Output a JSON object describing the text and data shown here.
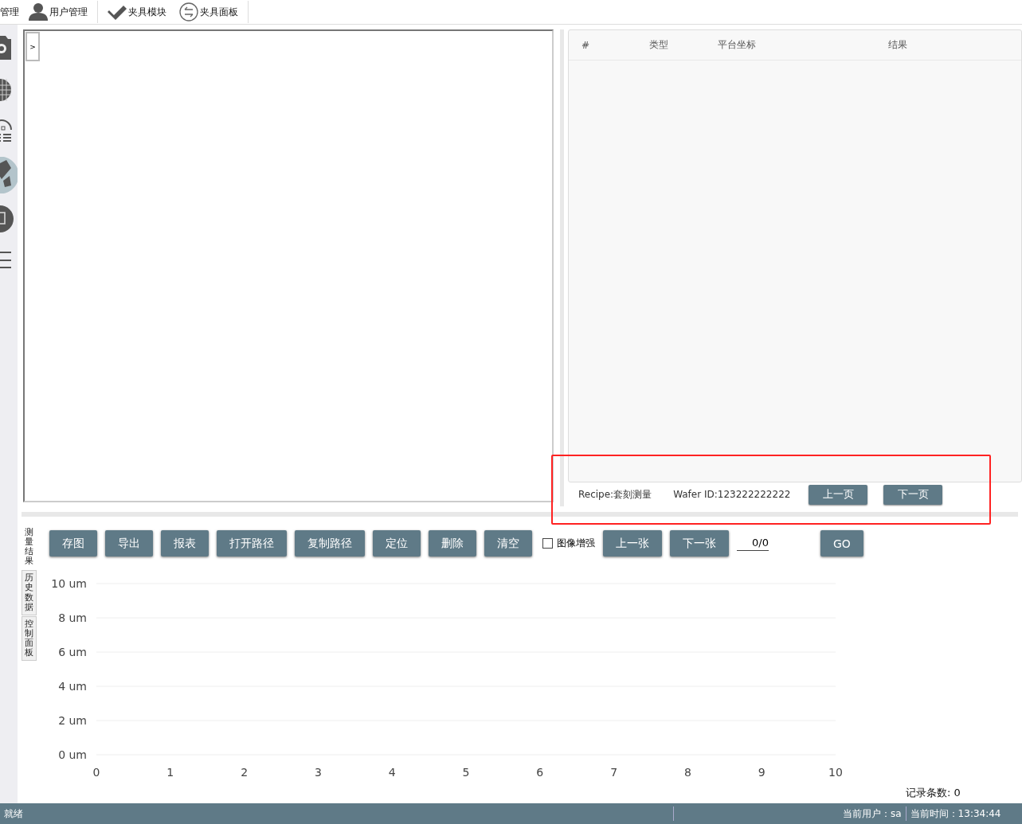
{
  "toolbar": {
    "items": [
      {
        "kind": "cut",
        "label": "管理"
      },
      {
        "kind": "user",
        "label": "用户管理"
      },
      {
        "kind": "separator"
      },
      {
        "kind": "tool",
        "label": "夹具模块"
      },
      {
        "kind": "swap",
        "label": "夹具面板"
      },
      {
        "kind": "separator"
      }
    ]
  },
  "sidebar": {
    "items": [
      {
        "kind": "camera",
        "selected": false
      },
      {
        "kind": "grid",
        "selected": false
      },
      {
        "kind": "dome",
        "selected": false
      },
      {
        "kind": "pencil",
        "selected": true
      },
      {
        "kind": "frame",
        "selected": false
      },
      {
        "kind": "menu",
        "selected": false
      }
    ]
  },
  "image_panel": {
    "expand_button": ">"
  },
  "result_table": {
    "columns": [
      "#",
      "类型",
      "平台坐标",
      "结果"
    ]
  },
  "table_footer": {
    "recipe": "Recipe:套刻测量",
    "wafer_id": "Wafer ID:123222222222",
    "buttons": [
      "上一页",
      "下一页"
    ]
  },
  "annotations": [
    {
      "kind": "rectangle"
    }
  ],
  "bottom_tabs": [
    {
      "label": "测量结果",
      "selected": true
    },
    {
      "label": "历史数据",
      "selected": false
    },
    {
      "label": "控制面板",
      "selected": false
    }
  ],
  "actions": {
    "buttons": [
      "存图",
      "导出",
      "报表",
      "打开路径",
      "复制路径",
      "定位",
      "删除",
      "清空"
    ],
    "enhance": {
      "label": "图像增强",
      "checked": false
    },
    "nav_buttons": [
      "上一张",
      "下一张"
    ],
    "page_field": "0/0",
    "go_button": "GO"
  },
  "chart": {
    "chart_data": {
      "type": "line",
      "grid": true,
      "xlim": [
        0,
        10
      ],
      "ylim": [
        0,
        10
      ],
      "xticks": [
        0,
        1,
        2,
        3,
        4,
        5,
        6,
        7,
        8,
        9,
        10
      ],
      "yticks": [
        {
          "value": 0,
          "label": "0 um"
        },
        {
          "value": 2,
          "label": "2 um"
        },
        {
          "value": 4,
          "label": "4 um"
        },
        {
          "value": 6,
          "label": "6 um"
        },
        {
          "value": 8,
          "label": "8 um"
        },
        {
          "value": 10,
          "label": "10 um"
        }
      ]
    }
  },
  "record_count": "记录条数: 0",
  "status_bar": {
    "status": "就绪",
    "user": "当前用户：sa",
    "time": "当前时间：13:34:44"
  }
}
